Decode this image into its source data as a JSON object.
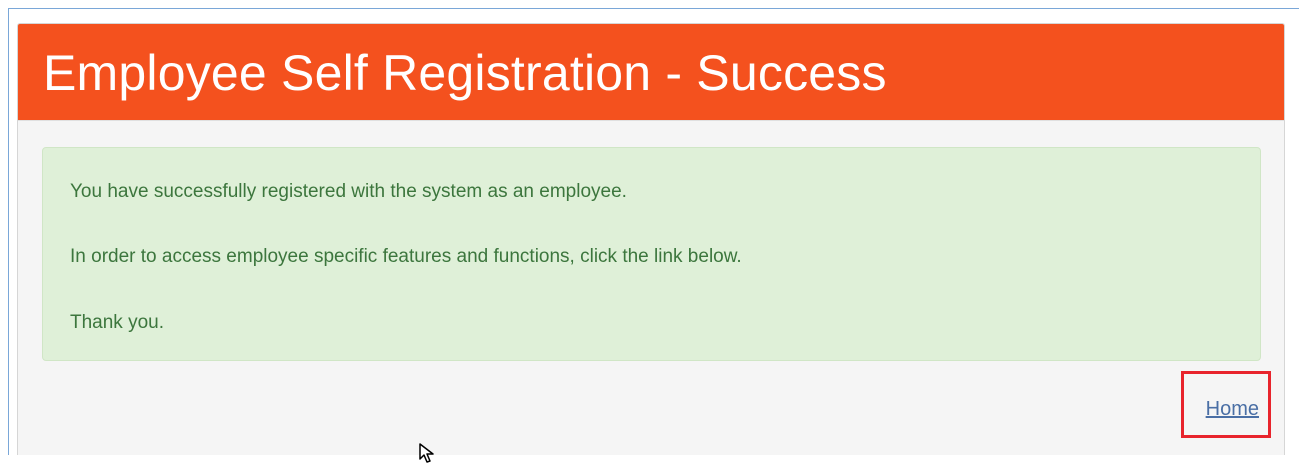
{
  "panel": {
    "title": "Employee Self Registration - Success",
    "header_color": "#f4511e"
  },
  "alert": {
    "line1": "You have successfully registered with the system as an employee.",
    "line2": "In order to access employee specific features and functions, click the link below.",
    "line3": "Thank you.",
    "background_color": "#dff0d8",
    "text_color": "#3c763d"
  },
  "home_link": {
    "label": "Home",
    "highlight_color": "#e8242c"
  },
  "cursor": {
    "icon": "arrow-cursor-icon"
  }
}
